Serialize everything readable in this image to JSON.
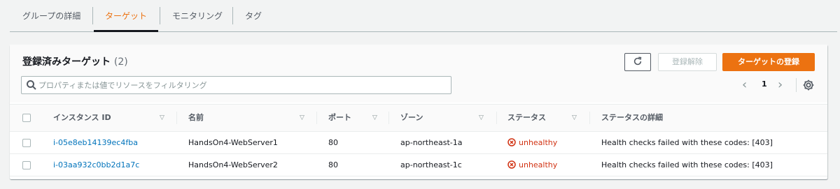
{
  "tabs": [
    {
      "label": "グループの詳細",
      "active": false
    },
    {
      "label": "ターゲット",
      "active": true
    },
    {
      "label": "モニタリング",
      "active": false
    },
    {
      "label": "タグ",
      "active": false
    }
  ],
  "panel": {
    "title": "登録済みターゲット",
    "count": "(2)"
  },
  "toolbar": {
    "refresh_icon": "refresh-icon",
    "deregister_label": "登録解除",
    "register_label": "ターゲットの登録"
  },
  "search": {
    "placeholder": "プロパティまたは値でリソースをフィルタリング",
    "value": ""
  },
  "pagination": {
    "current_page": "1"
  },
  "table": {
    "columns": [
      "インスタンス ID",
      "名前",
      "ポート",
      "ゾーン",
      "ステータス",
      "ステータスの詳細"
    ],
    "rows": [
      {
        "instance_id": "i-05e8eb14139ec4fba",
        "name": "HandsOn4-WebServer1",
        "port": "80",
        "zone": "ap-northeast-1a",
        "status": "unhealthy",
        "status_detail": "Health checks failed with these codes: [403]"
      },
      {
        "instance_id": "i-03aa932c0bb2d1a7c",
        "name": "HandsOn4-WebServer2",
        "port": "80",
        "zone": "ap-northeast-1c",
        "status": "unhealthy",
        "status_detail": "Health checks failed with these codes: [403]"
      }
    ]
  },
  "colors": {
    "accent": "#ec7211",
    "link": "#0073bb",
    "error": "#d13212"
  }
}
